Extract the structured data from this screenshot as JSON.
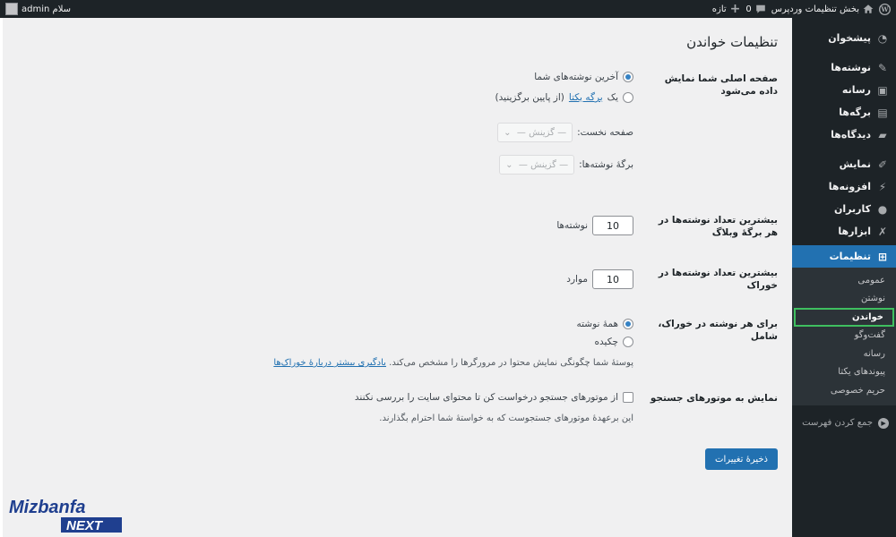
{
  "adminbar": {
    "site_name": "بخش تنظیمات وردپرس",
    "comments_count": "0",
    "new_label": "تازه",
    "greeting": "سلام admin"
  },
  "sidebar": {
    "items": [
      {
        "label": "پیشخوان",
        "icon": "dashboard-icon"
      },
      {
        "label": "نوشته‌ها",
        "icon": "pin-icon"
      },
      {
        "label": "رسانه",
        "icon": "media-icon"
      },
      {
        "label": "برگه‌ها",
        "icon": "page-icon"
      },
      {
        "label": "دیدگاه‌ها",
        "icon": "comment-icon"
      },
      {
        "label": "نمایش",
        "icon": "brush-icon"
      },
      {
        "label": "افزونه‌ها",
        "icon": "plugin-icon"
      },
      {
        "label": "کاربران",
        "icon": "user-icon"
      },
      {
        "label": "ابزارها",
        "icon": "wrench-icon"
      },
      {
        "label": "تنظیمات",
        "icon": "settings-icon"
      }
    ],
    "submenu": [
      "عمومی",
      "نوشتن",
      "خواندن",
      "گفت‌وگو",
      "رسانه",
      "پیوندهای یکتا",
      "حریم خصوصی"
    ],
    "collapse_label": "جمع کردن فهرست"
  },
  "page": {
    "title": "تنظیمات خواندن",
    "homepage": {
      "label": "صفحه اصلی شما نمایش داده می‌شود",
      "option_latest": "آخرین نوشته‌های شما",
      "option_static_prefix": "یک",
      "option_static_link": "برگه یکتا",
      "option_static_suffix": "(از پایین برگزینید)",
      "front_page_label": "صفحه نخست:",
      "posts_page_label": "برگهٔ نوشته‌ها:",
      "select_placeholder": "— گزینش —"
    },
    "posts_per_page": {
      "label": "بیشترین تعداد نوشته‌ها در هر برگهٔ وبلاگ",
      "value": "10",
      "unit": "نوشته‌ها"
    },
    "posts_per_rss": {
      "label": "بیشترین تعداد نوشته‌ها در خوراک",
      "value": "10",
      "unit": "موارد"
    },
    "feed_content": {
      "label": "برای هر نوشته در خوراک، شامل",
      "option_full": "همهٔ نوشته",
      "option_excerpt": "چکیده",
      "desc_text": "پوستهٔ شما چگونگی نمایش محتوا در مرورگرها را مشخص می‌کند.",
      "desc_link": "یادگیری بیشتر دربارهٔ خوراک‌ها"
    },
    "search_visibility": {
      "label": "نمایش به موتورهای جستجو",
      "checkbox_text": "از موتورهای جستجو درخواست کن تا محتوای سایت را بررسی نکنند",
      "desc": "این برعهدهٔ موتورهای جستجوست که به خواستهٔ شما احترام بگذارند."
    },
    "save_label": "ذخیرهٔ تغییرات"
  },
  "logo": {
    "line1": "Mizbanfa",
    "line2": "NEXT"
  }
}
